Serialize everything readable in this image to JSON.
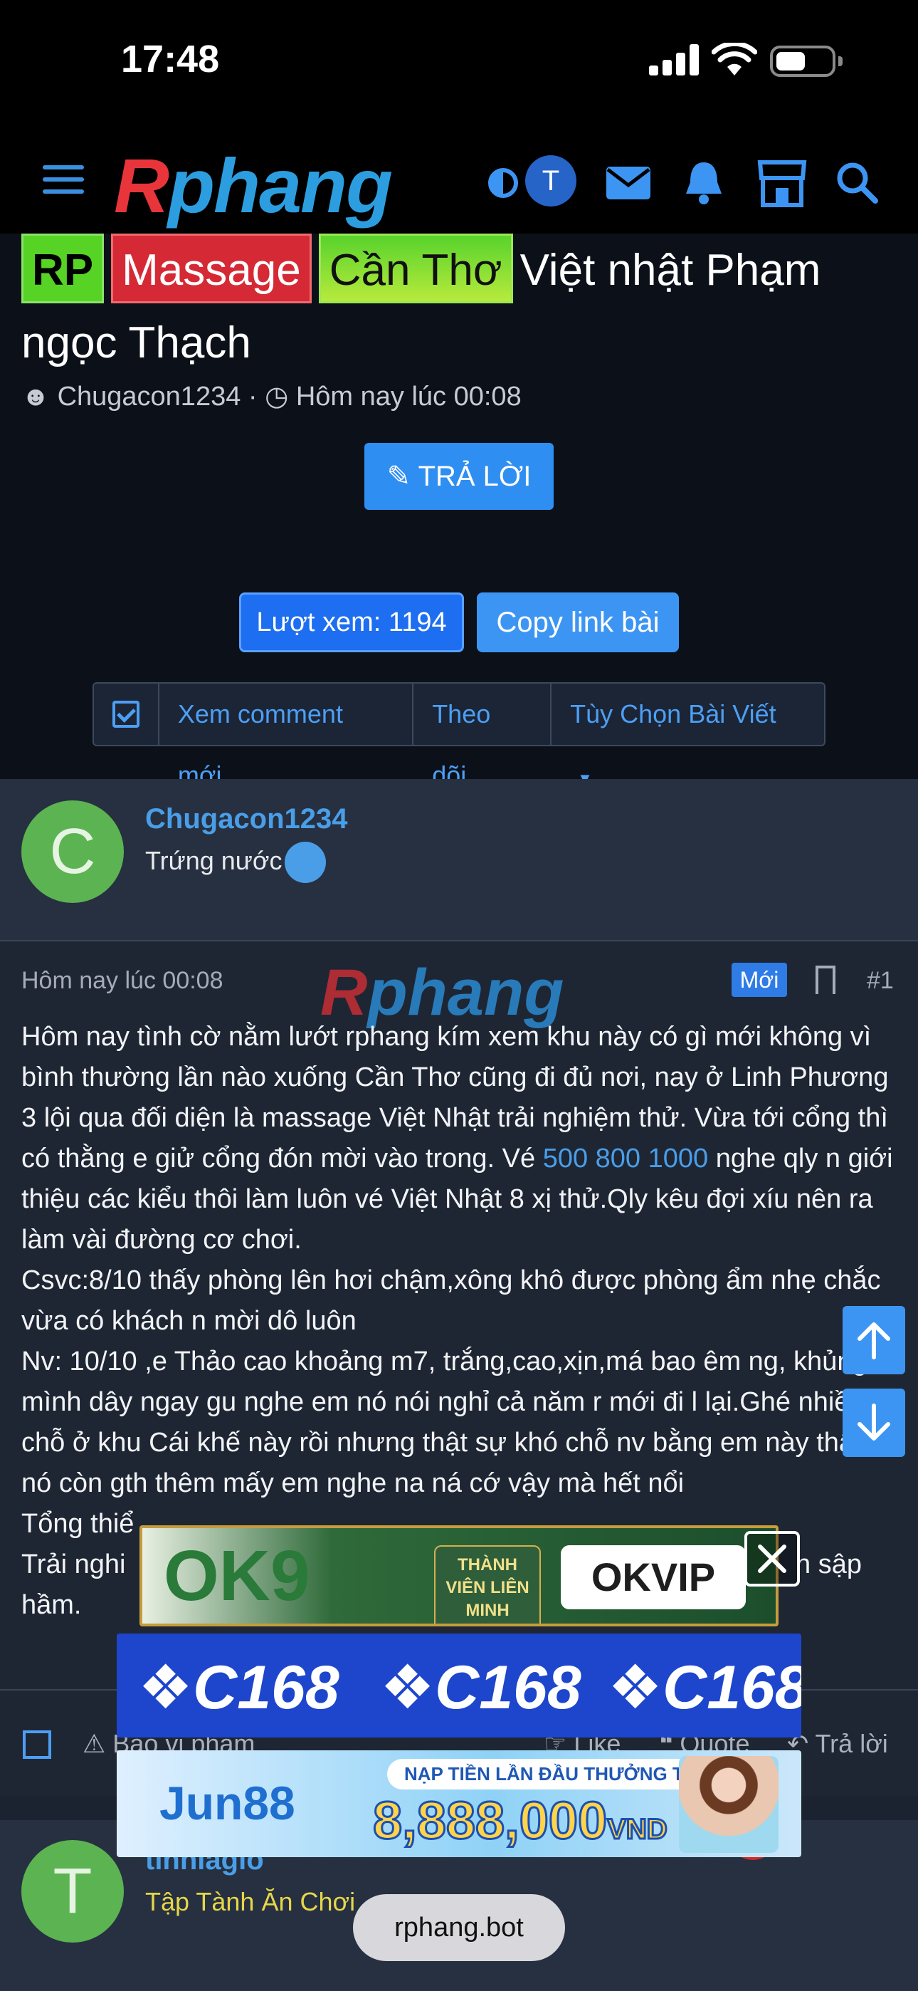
{
  "status": {
    "time": "17:48"
  },
  "header": {
    "logo": "Rphang",
    "avatar_letter": "T"
  },
  "thread": {
    "prefixes": [
      "RP",
      "Massage",
      "Cần Thơ"
    ],
    "title_line1": "Việt nhật Phạm",
    "title_line2": "ngọc Thạch",
    "author": "Chugacon1234",
    "time": "Hôm nay lúc 00:08",
    "reply_label": "TRẢ LỜI",
    "views_label": "Lượt xem: 1194",
    "copy_label": "Copy link bài",
    "toolbar": {
      "new_comments": "Xem comment mới",
      "follow": "Theo dõi",
      "options": "Tùy Chọn Bài Viết"
    }
  },
  "post": {
    "avatar_letter": "C",
    "username": "Chugacon1234",
    "rank": "Trứng nước",
    "date": "Hôm nay lúc 00:08",
    "badge": "Mới",
    "number": "#1",
    "watermark": "Rphang",
    "text_part1": "Hôm nay tình cờ nằm lướt rphang kím xem khu này có gì mới không vì bình thường lần nào xuống Cần Thơ cũng đi đủ nơi, nay ở Linh Phương 3 lội qua đối diện là massage Việt Nhật trải nghiệm thử. Vừa tới cổng thì có thằng e giử cổng đón mời vào trong. Vé ",
    "phone": "500 800 1000",
    "text_part2": " nghe qly n giới thiệu các kiểu thôi làm luôn vé Việt Nhật 8 xị thử.Qly kêu đợi xíu nên ra làm vài đường cơ chơi.",
    "line_csvc": "Csvc:8/10 thấy phòng lên hơi chậm,xông khô được phòng ẩm nhẹ chắc vừa có khách n mời dô luôn",
    "line_nv": "Nv: 10/10 ,e Thảo cao khoảng m7, trắng,cao,xịn,má bao êm ng, khủng mình dây ngay gu nghe em nó nói nghỉ cả năm r mới đi l lại.Ghé nhiều chỗ ở khu Cái khế này rồi nhưng thật sự khó chỗ nv bằng em này thật,qly nó còn gth thêm mấy em nghe na ná cớ vậy mà hết nổi",
    "line_tong": "Tổng thiể",
    "line_trai": "Trải nghi",
    "line_trai_end": "n sập",
    "line_ham": "hầm.",
    "actions": {
      "report": "Báo vi phạm",
      "like": "Like",
      "quote": "Quote",
      "reply": "Trả lời"
    }
  },
  "next_post": {
    "avatar_letter": "T",
    "username": "tinhlagio",
    "rank": "Tập Tành Ăn Chơi"
  },
  "ads": {
    "ok9": "OK9",
    "ok9_tag": "THÀNH VIÊN LIÊN MINH",
    "okvip": "OKVIP",
    "c168": "C168",
    "jun88": "Jun88",
    "jun88_promo": "NẠP TIỀN LẦN ĐẦU THƯỞNG TỚI",
    "jun88_amount": "8,888,000",
    "jun88_unit": "VND"
  },
  "bottom_url": "rphang.bot",
  "colors": {
    "accent": "#3d95f3",
    "brand_red": "#e8353b",
    "brand_blue": "#2c9ee0"
  }
}
